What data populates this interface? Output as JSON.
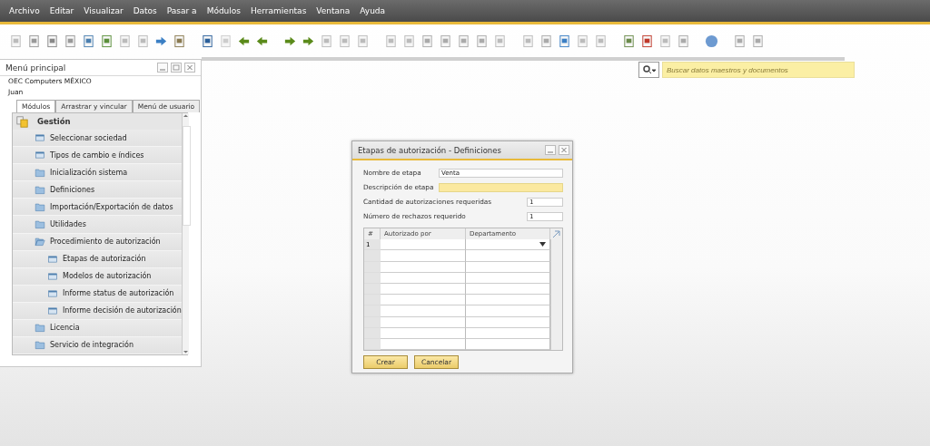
{
  "menu_bar": [
    "Archivo",
    "Editar",
    "Visualizar",
    "Datos",
    "Pasar a",
    "Módulos",
    "Herramientas",
    "Ventana",
    "Ayuda"
  ],
  "search": {
    "placeholder": "Buscar datos maestros y documentos"
  },
  "main_menu": {
    "title": "Menú principal",
    "company": "OEC Computers MÉXICO",
    "user": "Juan",
    "tabs": [
      {
        "label": "Módulos",
        "selected": true
      },
      {
        "label": "Arrastrar y vincular",
        "selected": false
      },
      {
        "label": "Menú de usuario",
        "selected": false
      }
    ],
    "module": "Gestión",
    "items": [
      {
        "label": "Seleccionar sociedad",
        "kind": "form"
      },
      {
        "label": "Tipos de cambio e índices",
        "kind": "form"
      },
      {
        "label": "Inicialización sistema",
        "kind": "folder",
        "expanded": false
      },
      {
        "label": "Definiciones",
        "kind": "folder",
        "expanded": false
      },
      {
        "label": "Importación/Exportación de datos",
        "kind": "folder",
        "expanded": false
      },
      {
        "label": "Utilidades",
        "kind": "folder",
        "expanded": false
      },
      {
        "label": "Procedimiento de autorización",
        "kind": "folder",
        "expanded": true,
        "children": [
          {
            "label": "Etapas de autorización",
            "kind": "form"
          },
          {
            "label": "Modelos de autorización",
            "kind": "form"
          },
          {
            "label": "Informe status de autorización",
            "kind": "form"
          },
          {
            "label": "Informe decisión de autorización",
            "kind": "form"
          }
        ]
      },
      {
        "label": "Licencia",
        "kind": "folder",
        "expanded": false
      },
      {
        "label": "Servicio de integración",
        "kind": "folder",
        "expanded": false
      }
    ]
  },
  "dialog": {
    "title": "Etapas de autorización - Definiciones",
    "fields": [
      {
        "label": "Nombre de etapa",
        "value": "Venta",
        "highlighted": false,
        "kind": "text"
      },
      {
        "label": "Descripción de etapa",
        "highlighted": true,
        "kind": "text"
      },
      {
        "label": "Cantidad de autorizaciones requeridas",
        "value": "1",
        "highlighted": false,
        "kind": "number"
      },
      {
        "label": "Número de rechazos requerido",
        "value": "1",
        "highlighted": false,
        "kind": "number"
      }
    ],
    "table": {
      "columns": [
        "#",
        "Autorizado por",
        "Departamento"
      ],
      "rows": [
        {
          "number": "1"
        }
      ]
    },
    "buttons": [
      "Crear",
      "Cancelar"
    ]
  }
}
